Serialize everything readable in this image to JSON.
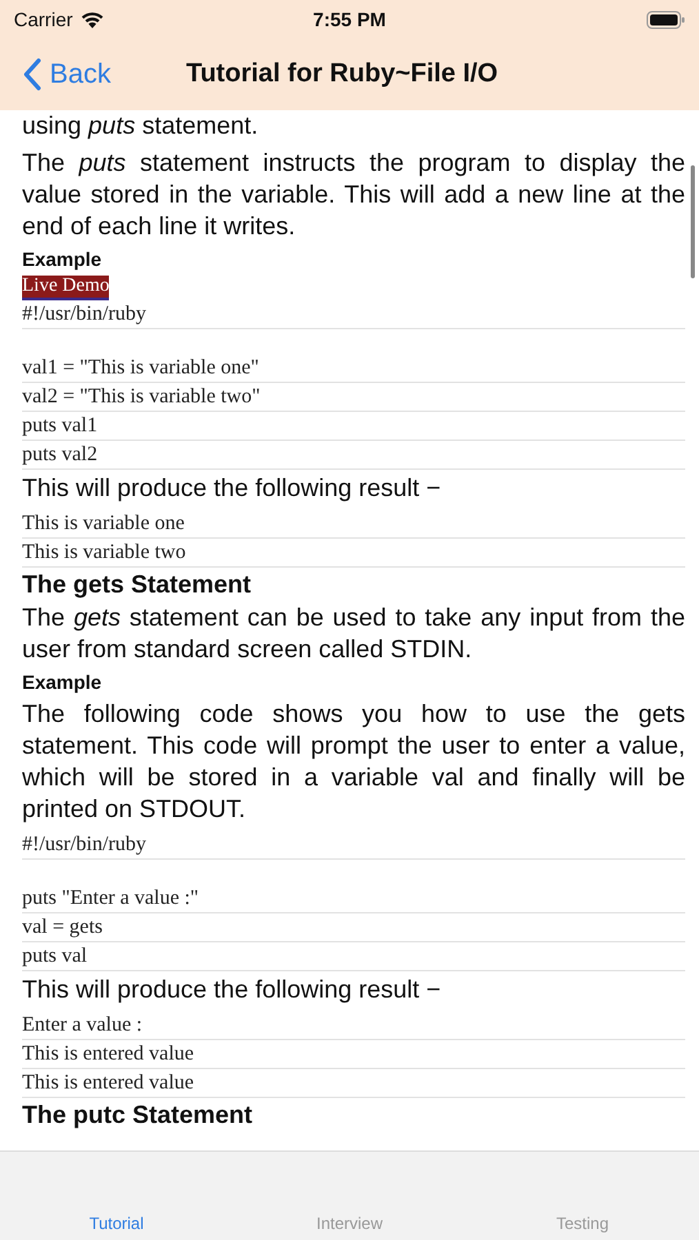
{
  "status_bar": {
    "carrier": "Carrier",
    "time": "7:55 PM"
  },
  "nav": {
    "back": "Back",
    "title": "Tutorial for Ruby~File I/O"
  },
  "content": [
    {
      "kind": "cut",
      "text": "using *puts* statement."
    },
    {
      "kind": "para",
      "text": "The *puts* statement instructs the program to display the value stored in the variable. This will add a new line at the end of each line it writes."
    },
    {
      "kind": "label",
      "text": "Example"
    },
    {
      "kind": "demo",
      "text": "Live Demo"
    },
    {
      "kind": "code",
      "lines": [
        "#!/usr/bin/ruby"
      ]
    },
    {
      "kind": "code",
      "lines": [
        "val1 = \"This is variable one\"",
        "val2 = \"This is variable two\"",
        "puts val1",
        "puts val2"
      ]
    },
    {
      "kind": "para",
      "text": "This will produce the following result −"
    },
    {
      "kind": "code",
      "lines": [
        "This is variable one",
        "This is variable two"
      ]
    },
    {
      "kind": "heading",
      "text": "The gets Statement"
    },
    {
      "kind": "para",
      "text": "The *gets* statement can be used to take any input from the user from standard screen called STDIN."
    },
    {
      "kind": "label",
      "text": "Example"
    },
    {
      "kind": "para",
      "text": "The following code shows you how to use the gets statement. This code will prompt the user to enter a value, which will be stored in a variable val and finally will be printed on STDOUT."
    },
    {
      "kind": "code",
      "lines": [
        "#!/usr/bin/ruby"
      ]
    },
    {
      "kind": "code",
      "lines": [
        "puts \"Enter a value :\"",
        "val = gets",
        "puts val"
      ]
    },
    {
      "kind": "para",
      "text": "This will produce the following result −"
    },
    {
      "kind": "code",
      "lines": [
        "Enter a value :",
        "This is entered value",
        "This is entered value"
      ]
    },
    {
      "kind": "heading",
      "text": "The putc Statement"
    }
  ],
  "tabs": [
    {
      "label": "Tutorial",
      "selected": true
    },
    {
      "label": "Interview",
      "selected": false
    },
    {
      "label": "Testing",
      "selected": false
    }
  ]
}
